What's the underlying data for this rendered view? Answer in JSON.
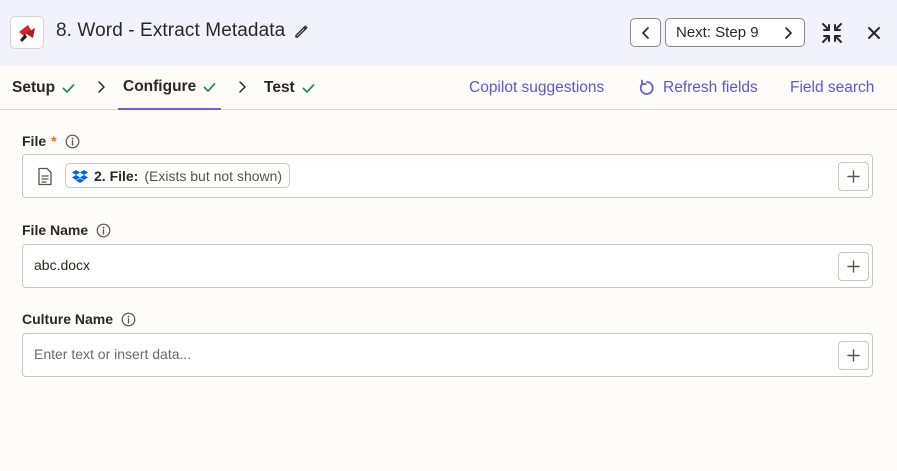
{
  "header": {
    "app_icon": "zapier-word-app-icon",
    "title": "8. Word - Extract Metadata",
    "edit_icon": "pencil-icon",
    "prev_icon": "chevron-left-icon",
    "next_label": "Next: Step 9",
    "next_icon": "chevron-right-icon",
    "collapse_icon": "collapse-icon",
    "close_icon": "close-icon"
  },
  "tabs": {
    "items": [
      {
        "label": "Setup",
        "status": "complete"
      },
      {
        "label": "Configure",
        "status": "complete",
        "active": true
      },
      {
        "label": "Test",
        "status": "complete"
      }
    ],
    "links": {
      "copilot": "Copilot suggestions",
      "refresh": "Refresh fields",
      "search": "Field search"
    }
  },
  "fields": {
    "file": {
      "label": "File",
      "required_mark": "*",
      "pill_step": "2. File:",
      "pill_desc": "(Exists but not shown)",
      "pill_icon": "dropbox-icon"
    },
    "file_name": {
      "label": "File Name",
      "value": "abc.docx"
    },
    "culture_name": {
      "label": "Culture Name",
      "placeholder": "Enter text or insert data..."
    }
  },
  "colors": {
    "accent": "#6b5ce7",
    "link": "#5e55d3",
    "check": "#2e8b57",
    "required": "#e66b1a",
    "header_bg": "#f2f2fc",
    "page_bg": "#fdfcf9"
  }
}
